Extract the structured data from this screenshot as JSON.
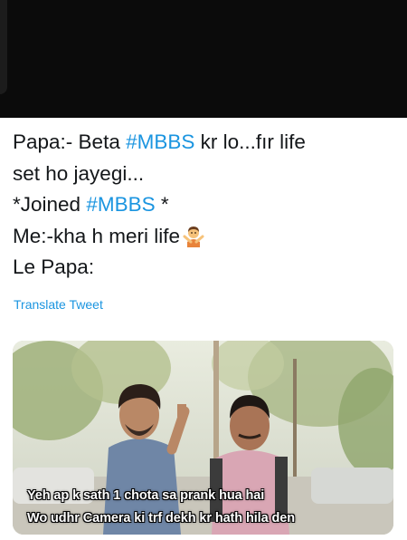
{
  "tweet": {
    "lines": {
      "l1_a": "Papa:- Beta ",
      "l1_tag": "#MBBS",
      "l1_b": " kr lo...fır life",
      "l2": "set ho jayegi...",
      "l3_a": "*Joined ",
      "l3_tag": "#MBBS",
      "l3_b": " *",
      "l4": "Me:-kha h meri life",
      "l5": "Le Papa:"
    },
    "translate_label": "Translate Tweet",
    "emoji": "person-gesturing-no-emoji"
  },
  "media": {
    "caption_line_1": "Yeh ap k sath 1 chota sa prank hua hai",
    "caption_line_2": "Wo udhr Camera ki trf dekh kr hath hila den"
  },
  "colors": {
    "hashtag": "#1b95e0",
    "text": "#14171a",
    "top_band": "#0b0b0b"
  }
}
